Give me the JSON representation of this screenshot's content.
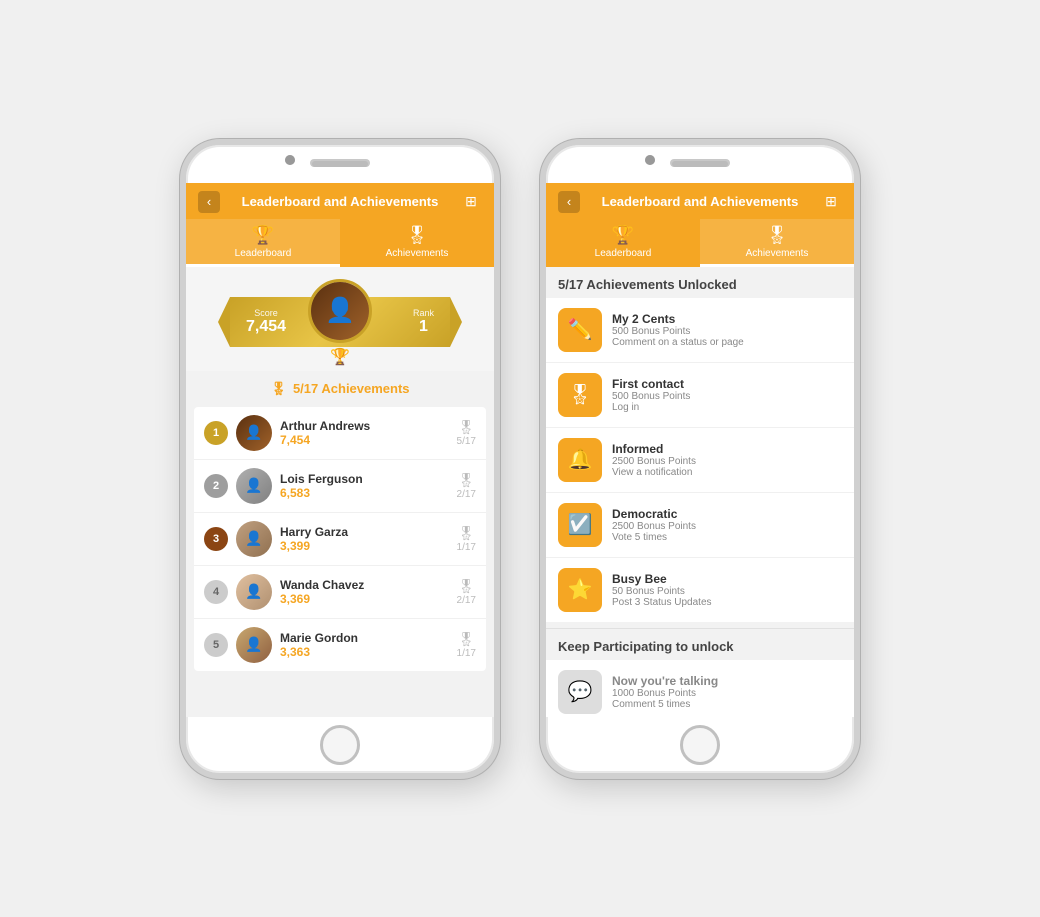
{
  "app": {
    "title": "Leaderboard and Achievements",
    "back_label": "‹",
    "settings_icon": "⊞"
  },
  "tabs": [
    {
      "id": "leaderboard",
      "label": "Leaderboard",
      "icon": "🏆",
      "active": true
    },
    {
      "id": "achievements",
      "label": "Achievements",
      "icon": "🎖",
      "active": false
    }
  ],
  "leaderboard": {
    "hero": {
      "score_label": "Score",
      "score_value": "7,454",
      "rank_label": "Rank",
      "rank_value": "1"
    },
    "achievements_badge": "5/17 Achievements",
    "players": [
      {
        "rank": "1",
        "name": "Arthur Andrews",
        "score": "7,454",
        "achievements": "5/17",
        "rank_class": "rank-1",
        "avatar_class": "avatar-1"
      },
      {
        "rank": "2",
        "name": "Lois Ferguson",
        "score": "6,583",
        "achievements": "2/17",
        "rank_class": "rank-2",
        "avatar_class": "avatar-2"
      },
      {
        "rank": "3",
        "name": "Harry Garza",
        "score": "3,399",
        "achievements": "1/17",
        "rank_class": "rank-3",
        "avatar_class": "avatar-3"
      },
      {
        "rank": "4",
        "name": "Wanda Chavez",
        "score": "3,369",
        "achievements": "2/17",
        "rank_class": "rank-other",
        "avatar_class": "avatar-4"
      },
      {
        "rank": "5",
        "name": "Marie Gordon",
        "score": "3,363",
        "achievements": "1/17",
        "rank_class": "rank-other",
        "avatar_class": "avatar-5"
      }
    ]
  },
  "achievements": {
    "unlocked_count": "5/17 Achievements Unlocked",
    "items": [
      {
        "id": "my2cents",
        "title": "My 2 Cents",
        "points": "500 Bonus Points",
        "desc": "Comment on a status or page",
        "icon": "✏️"
      },
      {
        "id": "firstcontact",
        "title": "First contact",
        "points": "500 Bonus Points",
        "desc": "Log in",
        "icon": "🎖"
      },
      {
        "id": "informed",
        "title": "Informed",
        "points": "2500 Bonus Points",
        "desc": "View a notification",
        "icon": "🔔"
      },
      {
        "id": "democratic",
        "title": "Democratic",
        "points": "2500 Bonus Points",
        "desc": "Vote 5 times",
        "icon": "☑️"
      },
      {
        "id": "busybee",
        "title": "Busy Bee",
        "points": "50 Bonus Points",
        "desc": "Post 3 Status Updates",
        "icon": "⭐"
      }
    ],
    "keep_participating": "Keep Participating to unlock",
    "locked_items": [
      {
        "id": "nowyretalking",
        "title": "Now you're talking",
        "points": "1000 Bonus Points",
        "desc": "Comment 5 times",
        "icon": "💬"
      }
    ]
  }
}
